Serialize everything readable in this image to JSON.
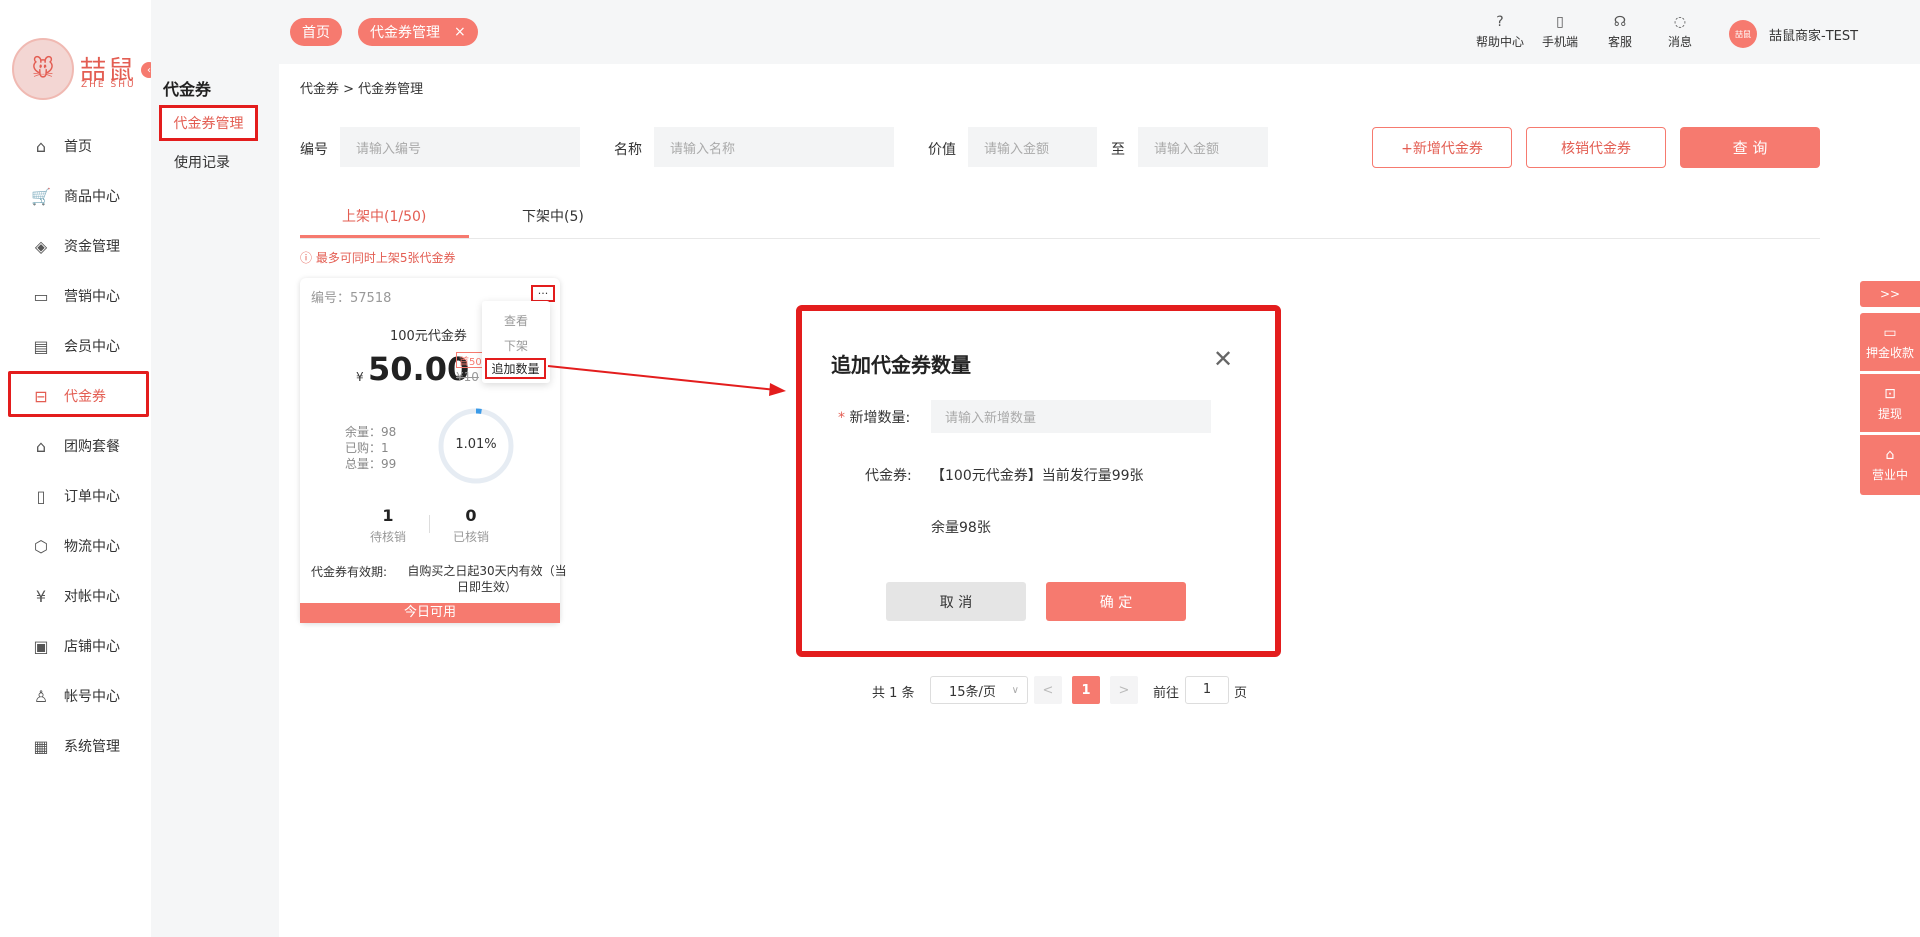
{
  "brand": {
    "name": "喆鼠",
    "sub": "ZHE SHU"
  },
  "sidebar": {
    "items": [
      {
        "label": "首页",
        "icon": "home-icon",
        "glyph": "⌂"
      },
      {
        "label": "商品中心",
        "icon": "cart-icon",
        "glyph": "🛒"
      },
      {
        "label": "资金管理",
        "icon": "layers-icon",
        "glyph": "◈"
      },
      {
        "label": "营销中心",
        "icon": "megaphone-icon",
        "glyph": "▭"
      },
      {
        "label": "会员中心",
        "icon": "vip-card-icon",
        "glyph": "▤"
      },
      {
        "label": "代金券",
        "icon": "voucher-icon",
        "glyph": "⊟"
      },
      {
        "label": "团购套餐",
        "icon": "bag-icon",
        "glyph": "⌂"
      },
      {
        "label": "订单中心",
        "icon": "document-icon",
        "glyph": "▯"
      },
      {
        "label": "物流中心",
        "icon": "box-icon",
        "glyph": "⬡"
      },
      {
        "label": "对帐中心",
        "icon": "yen-circle-icon",
        "glyph": "¥"
      },
      {
        "label": "店铺中心",
        "icon": "store-icon",
        "glyph": "▣"
      },
      {
        "label": "帐号中心",
        "icon": "user-icon",
        "glyph": "♙"
      },
      {
        "label": "系统管理",
        "icon": "monitor-icon",
        "glyph": "▦"
      }
    ]
  },
  "subnav": {
    "title": "代金券",
    "items": [
      "代金券管理",
      "使用记录"
    ]
  },
  "tabs": {
    "home": "首页",
    "current": "代金券管理",
    "close": "×"
  },
  "topbar": {
    "icons": [
      {
        "label": "帮助中心",
        "glyph": "?"
      },
      {
        "label": "手机端",
        "glyph": "▯"
      },
      {
        "label": "客服",
        "glyph": "☊"
      },
      {
        "label": "消息",
        "glyph": "◌"
      }
    ],
    "avatar": "喆鼠",
    "user": "喆鼠商家-TEST"
  },
  "breadcrumb": "代金券 > 代金券管理",
  "filters": {
    "code_label": "编号",
    "code_placeholder": "请输入编号",
    "name_label": "名称",
    "name_placeholder": "请输入名称",
    "value_label": "价值",
    "value_min_placeholder": "请输入金额",
    "to": "至",
    "value_max_placeholder": "请输入金额",
    "add_button": "+新增代金券",
    "verify_button": "核销代金券",
    "query_button": "查 询"
  },
  "list_tabs": {
    "on": "上架中(1/50)",
    "off": "下架中(5)"
  },
  "warning": "最多可同时上架5张代金券",
  "card": {
    "id": "编号：57518",
    "dots": "···",
    "name": "100元代金券",
    "yen": "¥",
    "price": "50.00",
    "full_tag": "首50",
    "orig": "¥10",
    "remaining": "余量：98",
    "bought": "已购：1",
    "total": "总量：99",
    "percent": "1.01%",
    "percent_value": 1.01,
    "pending_num": "1",
    "pending_label": "待核销",
    "used_num": "0",
    "used_label": "已核销",
    "valid_label": "代金券有效期:",
    "valid_value": "自购买之日起30天内有效（当日即生效）",
    "today": "今日可用"
  },
  "dropdown": {
    "view": "查看",
    "off": "下架",
    "add": "追加数量"
  },
  "modal": {
    "title": "追加代金券数量",
    "close": "✕",
    "qty_label": "新增数量:",
    "qty_required": "*",
    "qty_placeholder": "请输入新增数量",
    "voucher_label": "代金券:",
    "voucher_text": "【100元代金券】当前发行量99张",
    "remaining_text": "余量98张",
    "cancel": "取 消",
    "ok": "确 定"
  },
  "pagination": {
    "total": "共 1 条",
    "size": "15条/页",
    "prev": "<",
    "current": "1",
    "next": ">",
    "goto": "前往",
    "goto_value": "1",
    "page": "页"
  },
  "right_float": {
    "expand": ">>",
    "deposit": "押金收款",
    "withdraw": "提现",
    "open": "营业中"
  },
  "colors": {
    "accent": "#f67a6f",
    "highlight": "#e31d1d"
  }
}
